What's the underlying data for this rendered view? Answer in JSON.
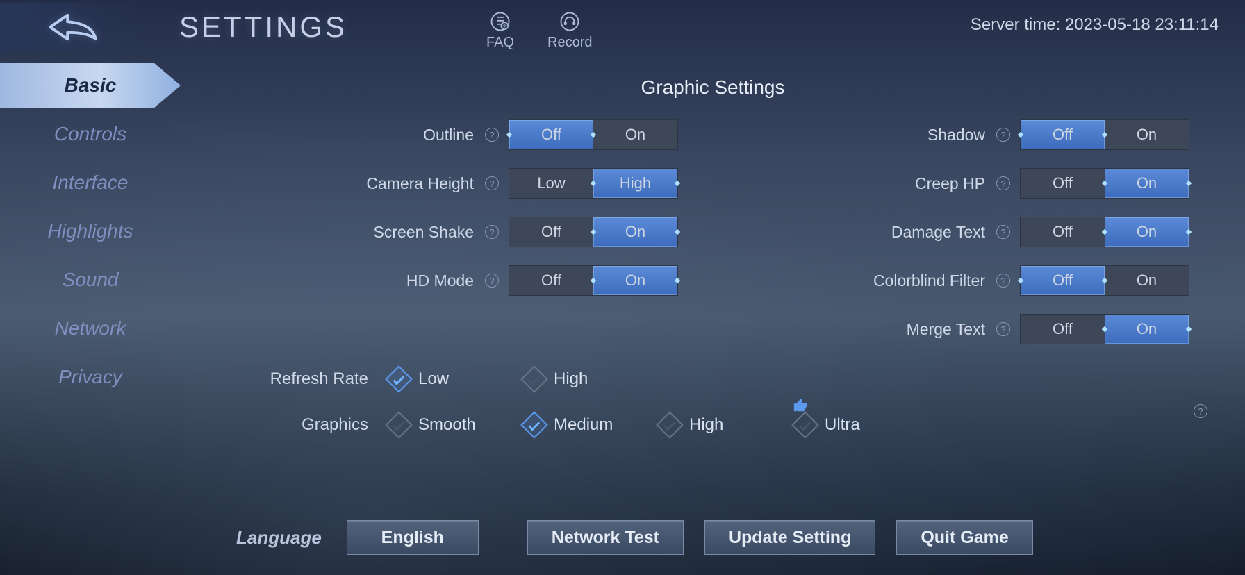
{
  "header": {
    "title": "SETTINGS",
    "faq": "FAQ",
    "record": "Record",
    "server_time_label": "Server time: ",
    "server_time_value": "2023-05-18 23:11:14"
  },
  "sidebar": {
    "items": [
      {
        "label": "Basic",
        "active": true
      },
      {
        "label": "Controls",
        "active": false
      },
      {
        "label": "Interface",
        "active": false
      },
      {
        "label": "Highlights",
        "active": false
      },
      {
        "label": "Sound",
        "active": false
      },
      {
        "label": "Network",
        "active": false
      },
      {
        "label": "Privacy",
        "active": false
      }
    ]
  },
  "section_title": "Graphic Settings",
  "toggles": {
    "left": [
      {
        "label": "Outline",
        "off": "Off",
        "on": "On",
        "value": "Off"
      },
      {
        "label": "Camera Height",
        "off": "Low",
        "on": "High",
        "value": "High"
      },
      {
        "label": "Screen Shake",
        "off": "Off",
        "on": "On",
        "value": "On"
      },
      {
        "label": "HD Mode",
        "off": "Off",
        "on": "On",
        "value": "On"
      }
    ],
    "right": [
      {
        "label": "Shadow",
        "off": "Off",
        "on": "On",
        "value": "Off"
      },
      {
        "label": "Creep HP",
        "off": "Off",
        "on": "On",
        "value": "On"
      },
      {
        "label": "Damage Text",
        "off": "Off",
        "on": "On",
        "value": "On"
      },
      {
        "label": "Colorblind Filter",
        "off": "Off",
        "on": "On",
        "value": "Off"
      },
      {
        "label": "Merge Text",
        "off": "Off",
        "on": "On",
        "value": "On"
      }
    ]
  },
  "refresh_rate": {
    "label": "Refresh Rate",
    "options": [
      "Low",
      "High"
    ],
    "value": "Low"
  },
  "graphics": {
    "label": "Graphics",
    "options": [
      "Smooth",
      "Medium",
      "High",
      "Ultra"
    ],
    "value": "Medium",
    "recommended": "Ultra"
  },
  "footer": {
    "language_label": "Language",
    "language_value": "English",
    "network_test": "Network Test",
    "update_setting": "Update Setting",
    "quit_game": "Quit Game"
  }
}
